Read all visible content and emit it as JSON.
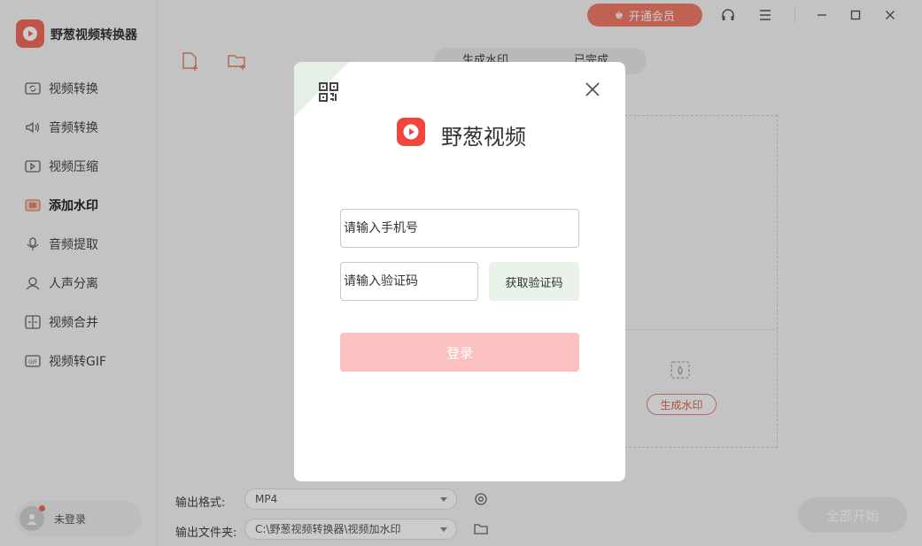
{
  "app": {
    "name": "野葱视频转换器"
  },
  "sidebar": {
    "items": [
      {
        "label": "视频转换",
        "icon": "video-convert-icon"
      },
      {
        "label": "音频转换",
        "icon": "audio-convert-icon"
      },
      {
        "label": "视频压缩",
        "icon": "video-compress-icon"
      },
      {
        "label": "添加水印",
        "icon": "watermark-icon",
        "active": true
      },
      {
        "label": "音频提取",
        "icon": "audio-extract-icon"
      },
      {
        "label": "人声分离",
        "icon": "vocal-separate-icon"
      },
      {
        "label": "视频合并",
        "icon": "video-merge-icon"
      },
      {
        "label": "视频转GIF",
        "icon": "video-to-gif-icon"
      }
    ],
    "user": {
      "label": "未登录"
    }
  },
  "topbar": {
    "vip_label": "开通会员"
  },
  "main": {
    "tabs": [
      {
        "label": "生成水印"
      },
      {
        "label": "已完成"
      }
    ],
    "generate_button": "生成水印",
    "output_format_label": "输出格式:",
    "output_format_value": "MP4",
    "output_folder_label": "输出文件夹:",
    "output_folder_value": "C:\\野葱视频转换器\\视频加水印",
    "start_all_label": "全部开始"
  },
  "modal": {
    "brand": "野葱视频",
    "phone_placeholder": "请输入手机号",
    "code_placeholder": "请输入验证码",
    "get_code_label": "获取验证码",
    "login_label": "登录"
  },
  "colors": {
    "accent": "#f26a5a",
    "brand_red": "#f0463e",
    "login_disabled": "#fbc0c0",
    "corner_green": "#e6efe6"
  }
}
